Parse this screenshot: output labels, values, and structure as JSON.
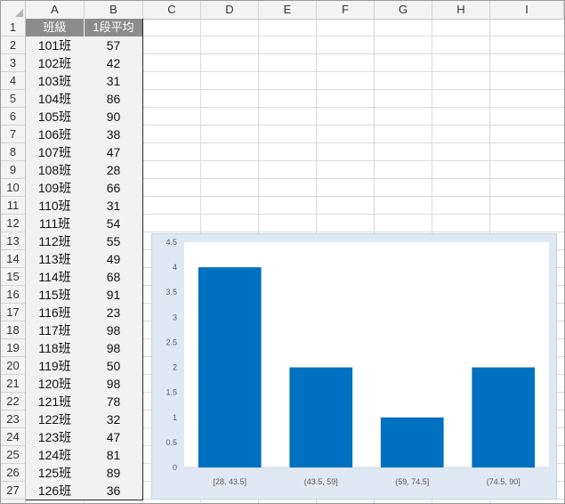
{
  "columns": [
    "A",
    "B",
    "C",
    "D",
    "E",
    "F",
    "G",
    "H",
    "I"
  ],
  "rows": [
    "1",
    "2",
    "3",
    "4",
    "5",
    "6",
    "7",
    "8",
    "9",
    "10",
    "11",
    "12",
    "13",
    "14",
    "15",
    "16",
    "17",
    "18",
    "19",
    "20",
    "21",
    "22",
    "23",
    "24",
    "25",
    "26",
    "27"
  ],
  "table": {
    "headers": [
      "班級",
      "1段平均"
    ],
    "records": [
      [
        "101班",
        "57"
      ],
      [
        "102班",
        "42"
      ],
      [
        "103班",
        "31"
      ],
      [
        "104班",
        "86"
      ],
      [
        "105班",
        "90"
      ],
      [
        "106班",
        "38"
      ],
      [
        "107班",
        "47"
      ],
      [
        "108班",
        "28"
      ],
      [
        "109班",
        "66"
      ],
      [
        "110班",
        "31"
      ],
      [
        "111班",
        "54"
      ],
      [
        "112班",
        "55"
      ],
      [
        "113班",
        "49"
      ],
      [
        "114班",
        "68"
      ],
      [
        "115班",
        "91"
      ],
      [
        "116班",
        "23"
      ],
      [
        "117班",
        "98"
      ],
      [
        "118班",
        "98"
      ],
      [
        "119班",
        "50"
      ],
      [
        "120班",
        "98"
      ],
      [
        "121班",
        "78"
      ],
      [
        "122班",
        "32"
      ],
      [
        "123班",
        "47"
      ],
      [
        "124班",
        "81"
      ],
      [
        "125班",
        "89"
      ],
      [
        "126班",
        "36"
      ]
    ]
  },
  "chart_data": {
    "type": "bar",
    "categories": [
      "[28, 43.5]",
      "(43.5, 59]",
      "(59, 74.5]",
      "(74.5, 90]"
    ],
    "values": [
      4,
      2,
      1,
      2
    ],
    "title": "",
    "xlabel": "",
    "ylabel": "",
    "ylim": [
      0,
      4.5
    ],
    "yticks": [
      "0",
      "0.5",
      "1",
      "1.5",
      "2",
      "2.5",
      "3",
      "3.5",
      "4",
      "4.5"
    ],
    "grid": false,
    "legend": "none",
    "bar_color": "#0070c0"
  }
}
